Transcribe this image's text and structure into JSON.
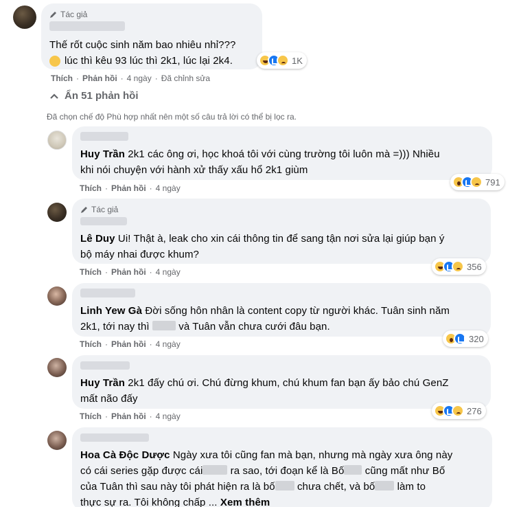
{
  "top_comment": {
    "author_tag": "Tác giả",
    "text_line1": "Thế rốt cuộc sinh năm bao nhiêu nhỉ???",
    "text_line2": "lúc thì kêu 93 lúc thì 2k1, lúc lại 2k4.",
    "reaction_count": "1K",
    "actions": {
      "like": "Thích",
      "reply": "Phản hồi",
      "time": "4 ngày",
      "edited": "Đã chỉnh sửa"
    }
  },
  "hide_replies": "Ẩn 51 phản hồi",
  "filter_note": "Đã chọn chế độ Phù hợp nhất nên một số câu trả lời có thể bị lọc ra.",
  "replies": [
    {
      "name": "Huy Trần",
      "text1": "2k1 các ông ơi, học khoá tôi với cùng trường tôi luôn mà =))) Nhiều",
      "text2": "khi nói chuyện với hành xử thấy xấu hổ 2k1 giùm",
      "reaction_count": "791",
      "reactions": [
        "wow-icon",
        "like-icon",
        "sad-icon"
      ],
      "actions": {
        "like": "Thích",
        "reply": "Phản hồi",
        "time": "4 ngày"
      }
    },
    {
      "author_tag": "Tác giả",
      "name": "Lê Duy",
      "text1": "Ui! Thật à, leak cho xin cái thông tin để sang tận nơi sửa lại giúp bạn ý",
      "text2": "bộ máy nhai được khum?",
      "reaction_count": "356",
      "reactions": [
        "haha-icon",
        "like-icon",
        "sad-icon"
      ],
      "actions": {
        "like": "Thích",
        "reply": "Phản hồi",
        "time": "4 ngày"
      }
    },
    {
      "name": "Linh Yew Gà",
      "text1": "Đời sống hôn nhân là content copy từ người khác. Tuân sinh năm",
      "text2a": "2k1, tới nay thì",
      "text2b": "và Tuân vẫn chưa cưới đâu bạn.",
      "reaction_count": "320",
      "reactions": [
        "wow-icon",
        "like-icon"
      ],
      "actions": {
        "like": "Thích",
        "reply": "Phản hồi",
        "time": "4 ngày"
      }
    },
    {
      "name": "Huy Trần",
      "text1": "2k1 đấy chú ơi. Chú đừng khum, chú khum fan bạn ấy bảo chú GenZ",
      "text2": "mất não đấy",
      "reaction_count": "276",
      "reactions": [
        "haha-icon",
        "like-icon",
        "sad-icon"
      ],
      "actions": {
        "like": "Thích",
        "reply": "Phản hồi",
        "time": "4 ngày"
      }
    },
    {
      "name": "Hoa Cà Độc Dược",
      "text1": "Ngày xưa tôi cũng fan mà bạn, nhưng mà ngày xưa ông này",
      "text2a": "có cái series gặp được cái",
      "text2b": "ra sao, tới đoạn kể là Bố",
      "text2c": "cũng mất như Bố",
      "text3a": "của Tuân thì sau này tôi phát hiện ra là bố",
      "text3b": "chưa chết, và bố",
      "text3c": "làm to",
      "text4": "thực sự ra. Tôi không chấp ...",
      "see_more": "Xem thêm"
    }
  ],
  "colors": {
    "bubble": "#f0f2f5",
    "meta": "#65676b",
    "like_blue": "#1877f2"
  }
}
